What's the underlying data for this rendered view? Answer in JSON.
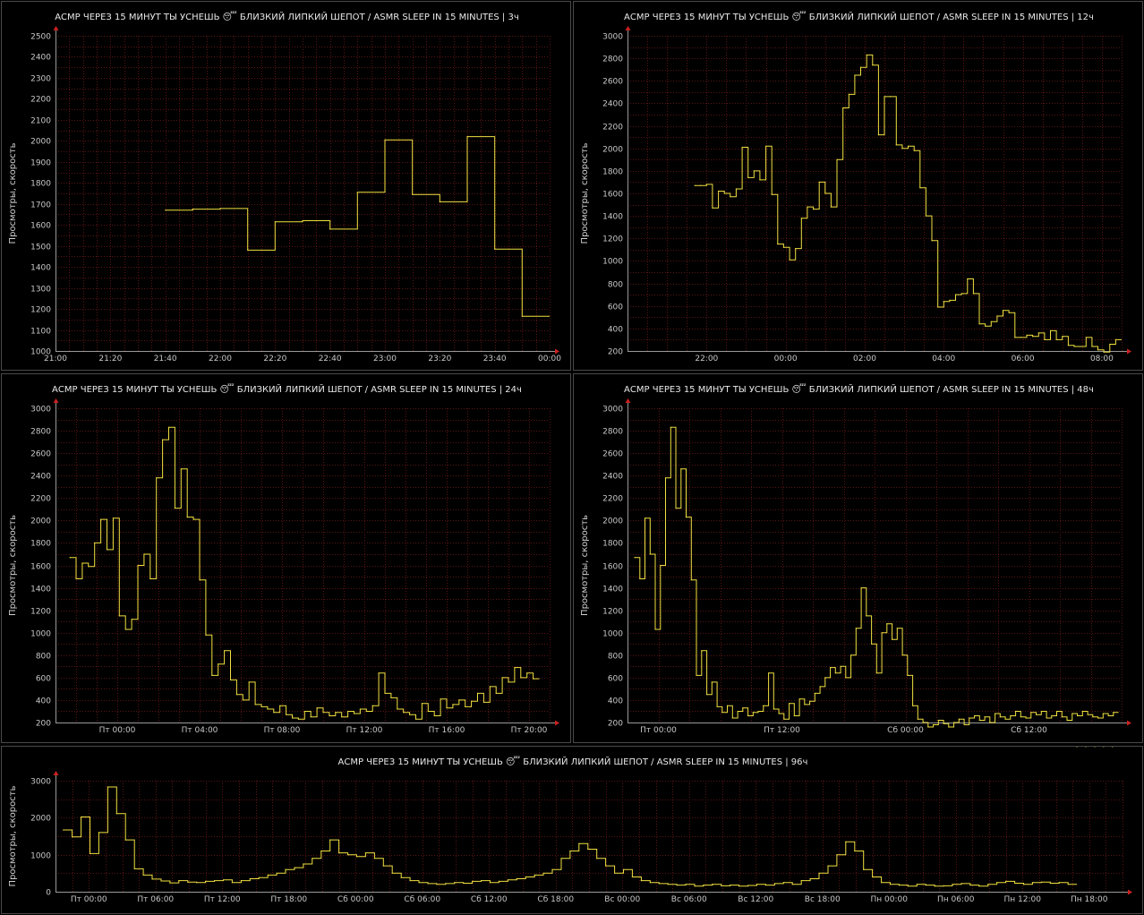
{
  "colors": {
    "background": "#000000",
    "series": "#f0e040",
    "grid": "#5a1414",
    "arrow": "#cc2020",
    "border": "#4a4a4a"
  },
  "chart_data": [
    {
      "id": "3h",
      "type": "line",
      "step": true,
      "title": "АСМР ЧЕРЕЗ 15 МИНУТ ТЫ УСНЕШЬ 😴 БЛИЗКИЙ ЛИПКИЙ ШЕПОТ / ASMR SLEEP IN 15 MINUTES | 3ч",
      "ylabel": "Просмотры, скорость",
      "ylim": [
        1000,
        2500
      ],
      "yticks": [
        1000,
        1100,
        1200,
        1300,
        1400,
        1500,
        1600,
        1700,
        1800,
        1900,
        2000,
        2100,
        2200,
        2300,
        2400,
        2500
      ],
      "yticklabels": [
        "1000",
        "1100",
        "1200",
        "1300",
        "1400",
        "1500",
        "1600",
        "1700",
        "1800",
        "1900",
        "2000",
        "2100",
        "2200",
        "2300",
        "2400",
        "2500"
      ],
      "xlim": [
        0,
        180
      ],
      "xticks": [
        0,
        20,
        40,
        60,
        80,
        100,
        120,
        140,
        160,
        180
      ],
      "xticklabels": [
        "21:00",
        "21:20",
        "21:40",
        "22:00",
        "22:20",
        "22:40",
        "23:00",
        "23:20",
        "23:40",
        "00:00"
      ],
      "x": [
        40,
        50,
        60,
        70,
        80,
        90,
        100,
        110,
        120,
        130,
        140,
        150,
        160,
        170
      ],
      "y": [
        1670,
        1675,
        1678,
        1480,
        1615,
        1620,
        1580,
        1755,
        2005,
        1745,
        1710,
        2020,
        1485,
        1165
      ]
    },
    {
      "id": "12h",
      "type": "line",
      "step": true,
      "title": "АСМР ЧЕРЕЗ 15 МИНУТ ТЫ УСНЕШЬ 😴 БЛИЗКИЙ ЛИПКИЙ ШЕПОТ / ASMR SLEEP IN 15 MINUTES | 12ч",
      "ylabel": "Просмотры, скорость",
      "ylim": [
        200,
        3000
      ],
      "yticks": [
        200,
        400,
        600,
        800,
        1000,
        1200,
        1400,
        1600,
        1800,
        2000,
        2200,
        2400,
        2600,
        2800,
        3000
      ],
      "yticklabels": [
        "200",
        "400",
        "600",
        "800",
        "1000",
        "1200",
        "1400",
        "1600",
        "1800",
        "2000",
        "2200",
        "2400",
        "2600",
        "2800",
        "3000"
      ],
      "xlim": [
        20.0,
        32.5
      ],
      "xticks": [
        22,
        24,
        26,
        28,
        30,
        32
      ],
      "xticklabels": [
        "22:00",
        "00:00",
        "02:00",
        "04:00",
        "06:00",
        "08:00"
      ],
      "x": [
        21.7,
        21.85,
        22.0,
        22.15,
        22.3,
        22.45,
        22.6,
        22.75,
        22.9,
        23.05,
        23.2,
        23.35,
        23.5,
        23.65,
        23.8,
        23.95,
        24.1,
        24.25,
        24.4,
        24.55,
        24.7,
        24.85,
        25.0,
        25.15,
        25.3,
        25.45,
        25.6,
        25.75,
        25.9,
        26.05,
        26.2,
        26.35,
        26.5,
        26.65,
        26.8,
        26.95,
        27.1,
        27.25,
        27.4,
        27.55,
        27.7,
        27.85,
        28.0,
        28.15,
        28.3,
        28.45,
        28.6,
        28.75,
        28.9,
        29.05,
        29.2,
        29.35,
        29.5,
        29.65,
        29.8,
        29.95,
        30.1,
        30.25,
        30.4,
        30.55,
        30.7,
        30.85,
        31.0,
        31.15,
        31.3,
        31.45,
        31.6,
        31.75,
        31.9,
        32.05,
        32.2,
        32.35
      ],
      "y": [
        1670,
        1670,
        1680,
        1470,
        1620,
        1600,
        1570,
        1640,
        2010,
        1740,
        1800,
        1720,
        2020,
        1590,
        1150,
        1120,
        1010,
        1110,
        1380,
        1480,
        1460,
        1700,
        1600,
        1480,
        1900,
        2360,
        2480,
        2650,
        2720,
        2830,
        2740,
        2120,
        2460,
        2460,
        2030,
        2000,
        2020,
        1980,
        1650,
        1400,
        1180,
        590,
        640,
        650,
        700,
        710,
        840,
        710,
        440,
        420,
        460,
        510,
        560,
        540,
        320,
        320,
        340,
        330,
        360,
        300,
        380,
        300,
        330,
        250,
        240,
        240,
        320,
        240,
        210,
        190,
        260,
        300
      ]
    },
    {
      "id": "24h",
      "type": "line",
      "step": true,
      "title": "АСМР ЧЕРЕЗ 15 МИНУТ ТЫ УСНЕШЬ 😴 БЛИЗКИЙ ЛИПКИЙ ШЕПОТ / ASMR SLEEP IN 15 MINUTES | 24ч",
      "ylabel": "Просмотры, скорость",
      "ylim": [
        200,
        3000
      ],
      "yticks": [
        200,
        400,
        600,
        800,
        1000,
        1200,
        1400,
        1600,
        1800,
        2000,
        2200,
        2400,
        2600,
        2800,
        3000
      ],
      "yticklabels": [
        "200",
        "400",
        "600",
        "800",
        "1000",
        "1200",
        "1400",
        "1600",
        "1800",
        "2000",
        "2200",
        "2400",
        "2600",
        "2800",
        "3000"
      ],
      "xlim": [
        21.0,
        45.0
      ],
      "xticks": [
        24,
        28,
        32,
        36,
        40,
        44
      ],
      "xticklabels": [
        "Пт 00:00",
        "Пт 04:00",
        "Пт 08:00",
        "Пт 12:00",
        "Пт 16:00",
        "Пт 20:00"
      ],
      "x": [
        21.7,
        22.0,
        22.3,
        22.6,
        22.9,
        23.2,
        23.5,
        23.8,
        24.1,
        24.4,
        24.7,
        25.0,
        25.3,
        25.6,
        25.9,
        26.2,
        26.5,
        26.8,
        27.1,
        27.4,
        27.7,
        28.0,
        28.3,
        28.6,
        28.9,
        29.2,
        29.5,
        29.8,
        30.1,
        30.4,
        30.7,
        31.0,
        31.3,
        31.6,
        31.9,
        32.2,
        32.5,
        32.8,
        33.1,
        33.4,
        33.7,
        34.0,
        34.3,
        34.6,
        34.9,
        35.2,
        35.5,
        35.8,
        36.1,
        36.4,
        36.7,
        37.0,
        37.3,
        37.6,
        37.9,
        38.2,
        38.5,
        38.8,
        39.1,
        39.4,
        39.7,
        40.0,
        40.3,
        40.6,
        40.9,
        41.2,
        41.5,
        41.8,
        42.1,
        42.4,
        42.7,
        43.0,
        43.3,
        43.6,
        43.9,
        44.2
      ],
      "y": [
        1670,
        1480,
        1620,
        1590,
        1800,
        2010,
        1740,
        2020,
        1150,
        1030,
        1120,
        1600,
        1700,
        1480,
        2380,
        2720,
        2830,
        2110,
        2460,
        2030,
        2010,
        1470,
        980,
        620,
        720,
        840,
        580,
        450,
        400,
        560,
        360,
        340,
        320,
        290,
        350,
        270,
        240,
        230,
        300,
        250,
        330,
        290,
        260,
        290,
        250,
        300,
        280,
        320,
        300,
        350,
        640,
        460,
        420,
        320,
        290,
        270,
        230,
        370,
        300,
        260,
        410,
        330,
        360,
        400,
        340,
        390,
        460,
        380,
        520,
        460,
        600,
        560,
        690,
        600,
        640,
        590
      ]
    },
    {
      "id": "48h",
      "type": "line",
      "step": true,
      "title": "АСМР ЧЕРЕЗ 15 МИНУТ ТЫ УСНЕШЬ 😴 БЛИЗКИЙ ЛИПКИЙ ШЕПОТ / ASMR SLEEP IN 15 MINUTES | 48ч",
      "ylabel": "Просмотры, скорость",
      "ylim": [
        200,
        3000
      ],
      "yticks": [
        200,
        400,
        600,
        800,
        1000,
        1200,
        1400,
        1600,
        1800,
        2000,
        2200,
        2400,
        2600,
        2800,
        3000
      ],
      "yticklabels": [
        "200",
        "400",
        "600",
        "800",
        "1000",
        "1200",
        "1400",
        "1600",
        "1800",
        "2000",
        "2200",
        "2400",
        "2600",
        "2800",
        "3000"
      ],
      "xlim": [
        21.0,
        69.0
      ],
      "xticks": [
        24,
        36,
        48,
        60
      ],
      "xticklabels": [
        "Пт 00:00",
        "Пт 12:00",
        "Сб 00:00",
        "Сб 12:00"
      ],
      "x": [
        21.7,
        22.2,
        22.7,
        23.2,
        23.7,
        24.2,
        24.7,
        25.2,
        25.7,
        26.2,
        26.7,
        27.2,
        27.7,
        28.2,
        28.7,
        29.2,
        29.7,
        30.2,
        30.7,
        31.2,
        31.7,
        32.2,
        32.7,
        33.2,
        33.7,
        34.2,
        34.7,
        35.2,
        35.7,
        36.2,
        36.7,
        37.2,
        37.7,
        38.2,
        38.7,
        39.2,
        39.7,
        40.2,
        40.7,
        41.2,
        41.7,
        42.2,
        42.7,
        43.2,
        43.7,
        44.2,
        44.7,
        45.2,
        45.7,
        46.2,
        46.7,
        47.2,
        47.7,
        48.2,
        48.7,
        49.2,
        49.7,
        50.2,
        50.7,
        51.2,
        51.7,
        52.2,
        52.7,
        53.2,
        53.7,
        54.2,
        54.7,
        55.2,
        55.7,
        56.2,
        56.7,
        57.2,
        57.7,
        58.2,
        58.7,
        59.2,
        59.7,
        60.2,
        60.7,
        61.2,
        61.7,
        62.2,
        62.7,
        63.2,
        63.7,
        64.2,
        64.7,
        65.2,
        65.7,
        66.2,
        66.7,
        67.2,
        67.7,
        68.2
      ],
      "y": [
        1670,
        1480,
        2020,
        1700,
        1030,
        1600,
        2380,
        2830,
        2110,
        2460,
        2030,
        1470,
        620,
        840,
        450,
        560,
        340,
        290,
        350,
        240,
        300,
        330,
        260,
        290,
        300,
        350,
        640,
        320,
        280,
        230,
        370,
        260,
        410,
        360,
        390,
        460,
        520,
        600,
        690,
        640,
        700,
        600,
        800,
        1040,
        1400,
        1150,
        900,
        640,
        1000,
        1080,
        940,
        1040,
        800,
        620,
        350,
        230,
        200,
        160,
        180,
        220,
        190,
        160,
        200,
        230,
        180,
        240,
        260,
        220,
        250,
        200,
        280,
        250,
        230,
        260,
        300,
        250,
        240,
        290,
        270,
        300,
        240,
        260,
        300,
        250,
        220,
        280,
        260,
        300,
        270,
        250,
        240,
        280,
        260,
        290
      ]
    },
    {
      "id": "96h",
      "type": "line",
      "step": true,
      "title": "АСМР ЧЕРЕЗ 15 МИНУТ ТЫ УСНЕШЬ 😴 БЛИЗКИЙ ЛИПКИЙ ШЕПОТ / ASMR SLEEP IN 15 MINUTES | 96ч",
      "ylabel": "Просмотры, скорость",
      "ylim": [
        0,
        3000
      ],
      "yticks": [
        0,
        1000,
        2000,
        3000
      ],
      "yticklabels": [
        "0",
        "1000",
        "2000",
        "3000"
      ],
      "xlim": [
        21.0,
        117.0
      ],
      "xticks": [
        24,
        30,
        36,
        42,
        48,
        54,
        60,
        66,
        72,
        78,
        84,
        90,
        96,
        102,
        108,
        114
      ],
      "xticklabels": [
        "Пт 00:00",
        "Пт 06:00",
        "Пт 12:00",
        "Пт 18:00",
        "Сб 00:00",
        "Сб 06:00",
        "Сб 12:00",
        "Сб 18:00",
        "Вс 00:00",
        "Вс 06:00",
        "Вс 12:00",
        "Вс 18:00",
        "Пн 00:00",
        "Пн 06:00",
        "Пн 12:00",
        "Пн 18:00"
      ],
      "x": [
        21.7,
        22.5,
        23.3,
        24.1,
        24.9,
        25.7,
        26.5,
        27.3,
        28.1,
        28.9,
        29.7,
        30.5,
        31.3,
        32.1,
        32.9,
        33.7,
        34.5,
        35.3,
        36.1,
        36.9,
        37.7,
        38.5,
        39.3,
        40.1,
        40.9,
        41.7,
        42.5,
        43.3,
        44.1,
        44.9,
        45.7,
        46.5,
        47.3,
        48.1,
        48.9,
        49.7,
        50.5,
        51.3,
        52.1,
        52.9,
        53.7,
        54.5,
        55.3,
        56.1,
        56.9,
        57.7,
        58.5,
        59.3,
        60.1,
        60.9,
        61.7,
        62.5,
        63.3,
        64.1,
        64.9,
        65.7,
        66.5,
        67.3,
        68.1,
        68.9,
        69.7,
        70.5,
        71.3,
        72.1,
        72.9,
        73.7,
        74.5,
        75.3,
        76.1,
        76.9,
        77.7,
        78.5,
        79.3,
        80.1,
        80.9,
        81.7,
        82.5,
        83.3,
        84.1,
        84.9,
        85.7,
        86.5,
        87.3,
        88.1,
        88.9,
        89.7,
        90.5,
        91.3,
        92.1,
        92.9,
        93.7,
        94.5,
        95.3,
        96.1,
        96.9,
        97.7,
        98.5,
        99.3,
        100.1,
        100.9,
        101.7,
        102.5,
        103.3,
        104.1,
        104.9,
        105.7,
        106.5,
        107.3,
        108.1,
        108.9,
        109.7,
        110.5,
        111.3,
        112.1,
        112.9,
        113.7,
        114.5,
        115.3,
        116.1
      ],
      "y": [
        1670,
        1480,
        2020,
        1030,
        1600,
        2830,
        2110,
        1400,
        620,
        450,
        340,
        290,
        240,
        300,
        260,
        250,
        280,
        300,
        320,
        250,
        300,
        350,
        380,
        450,
        500,
        600,
        650,
        750,
        900,
        1100,
        1400,
        1050,
        1000,
        950,
        1050,
        900,
        700,
        500,
        380,
        300,
        250,
        220,
        200,
        220,
        250,
        230,
        280,
        300,
        250,
        280,
        320,
        350,
        400,
        450,
        500,
        600,
        900,
        1100,
        1300,
        1150,
        900,
        700,
        500,
        600,
        400,
        300,
        250,
        220,
        200,
        180,
        200,
        150,
        180,
        200,
        160,
        180,
        150,
        170,
        200,
        180,
        220,
        250,
        200,
        300,
        350,
        500,
        700,
        1000,
        1350,
        1100,
        600,
        400,
        250,
        200,
        180,
        150,
        200,
        180,
        150,
        160,
        200,
        220,
        180,
        150,
        200,
        250,
        280,
        230,
        200,
        250,
        260,
        230,
        250,
        200
      ]
    }
  ]
}
